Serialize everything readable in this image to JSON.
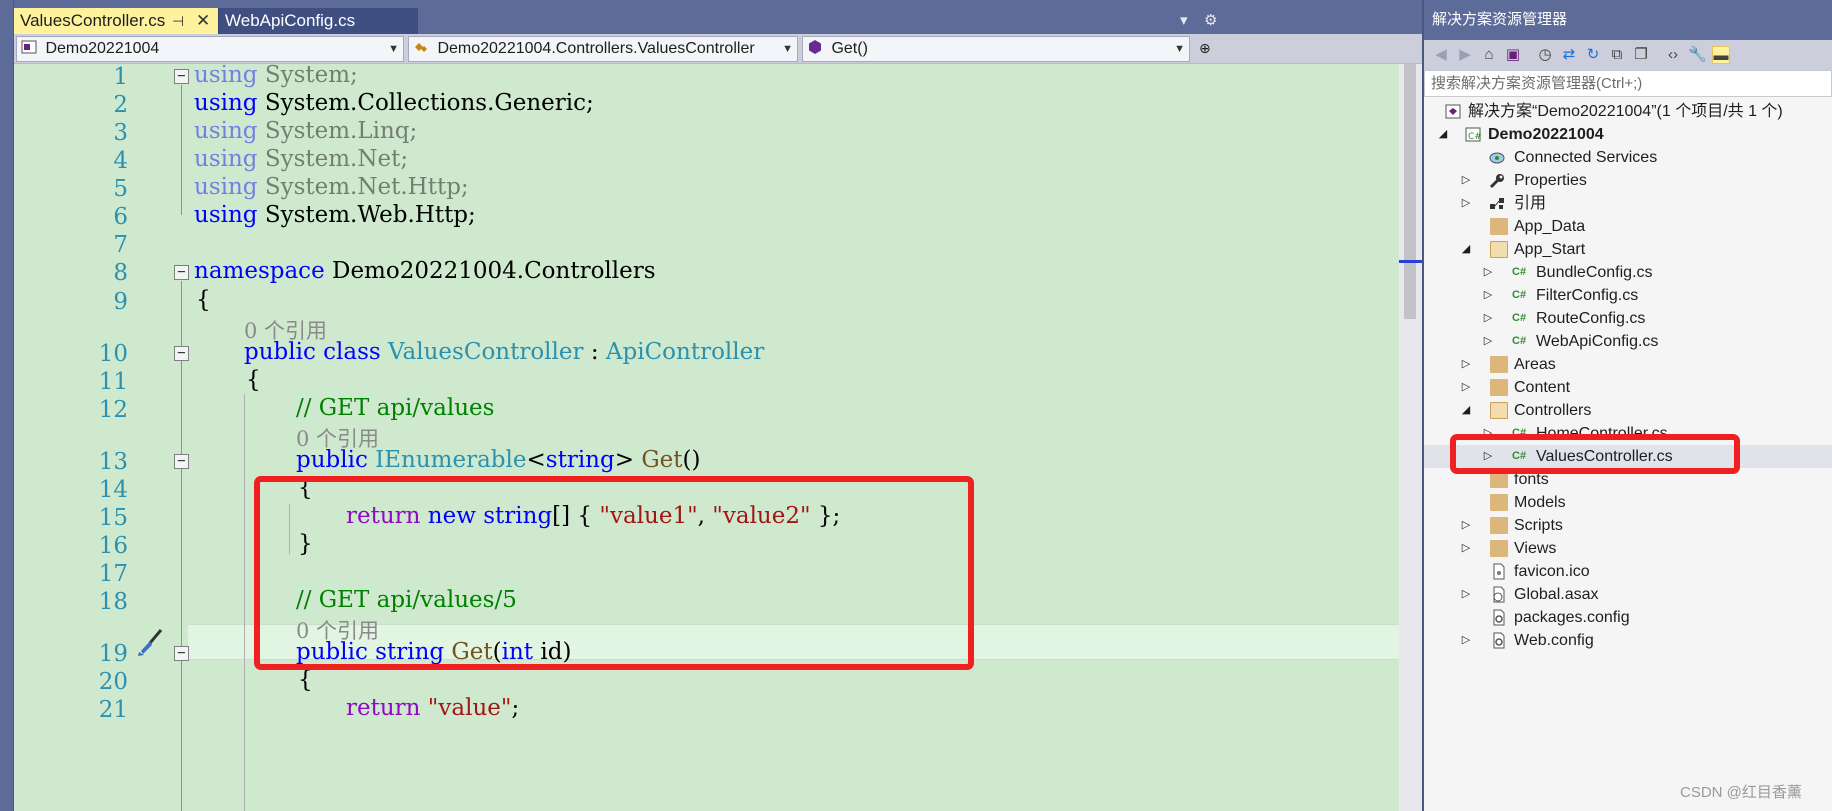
{
  "tabs": [
    {
      "label": "ValuesController.cs",
      "active": true
    },
    {
      "label": "WebApiConfig.cs",
      "active": false
    }
  ],
  "tab_tools": {
    "dropdown": "▾",
    "settings": "⚙"
  },
  "navbar": {
    "project": "Demo20221004",
    "class": "Demo20221004.Controllers.ValuesController",
    "member": "Get()"
  },
  "code": {
    "line_numbers": [
      "1",
      "2",
      "3",
      "4",
      "5",
      "6",
      "7",
      "8",
      "9",
      "10",
      "11",
      "12",
      "13",
      "14",
      "15",
      "16",
      "17",
      "18",
      "19",
      "20",
      "21"
    ],
    "l1_kw": "using",
    "l1_rest": " System;",
    "l2_kw": "using",
    "l2_rest": " System.Collections.Generic;",
    "l3_kw": "using",
    "l3_rest": " System.Linq;",
    "l4_kw": "using",
    "l4_rest": " System.Net;",
    "l5_kw": "using",
    "l5_rest": " System.Net.Http;",
    "l6_kw": "using",
    "l6_rest": " System.Web.Http;",
    "l8_kw": "namespace",
    "l8_rest": " Demo20221004.Controllers",
    "l9": "{",
    "lens1": "0 个引用",
    "l10_kw1": "public",
    "l10_kw2": "class",
    "l10_ty1": "ValuesController",
    "l10_sep": " : ",
    "l10_ty2": "ApiController",
    "l11": "{",
    "l12_cm": "// GET api/values",
    "lens2": "0 个引用",
    "l13_kw": "public",
    "l13_ty": "IEnumerable",
    "l13_lt": "<",
    "l13_kw2": "string",
    "l13_gt": ">",
    "l13_me": "Get",
    "l13_par": "()",
    "l14": "{",
    "l15_ctl": "return",
    "l15_kw": "new",
    "l15_kw2": "string",
    "l15_mid": "[] { ",
    "l15_s1": "\"value1\"",
    "l15_comma": ", ",
    "l15_s2": "\"value2\"",
    "l15_end": " };",
    "l16": "}",
    "l18_cm": "// GET api/values/5",
    "lens3": "0 个引用",
    "l19_kw": "public",
    "l19_kw2": "string",
    "l19_me": "Get",
    "l19_p1": "(",
    "l19_kw3": "int",
    "l19_p2": " id)",
    "l20": "{",
    "l21_ctl": "return",
    "l21_st": "\"value\"",
    "l21_end": ";"
  },
  "solution_explorer": {
    "title": "解决方案资源管理器",
    "search_placeholder": "搜索解决方案资源管理器(Ctrl+;)",
    "items": [
      {
        "label": "解决方案“Demo20221004”(1 个项目/共 1 个)",
        "expander": ""
      },
      {
        "label": "Demo20221004",
        "expander": "◢"
      },
      {
        "label": "Connected Services",
        "expander": ""
      },
      {
        "label": "Properties",
        "expander": "▷"
      },
      {
        "label": "引用",
        "expander": "▷"
      },
      {
        "label": "App_Data",
        "expander": ""
      },
      {
        "label": "App_Start",
        "expander": "◢"
      },
      {
        "label": "BundleConfig.cs",
        "expander": "▷"
      },
      {
        "label": "FilterConfig.cs",
        "expander": "▷"
      },
      {
        "label": "RouteConfig.cs",
        "expander": "▷"
      },
      {
        "label": "WebApiConfig.cs",
        "expander": "▷"
      },
      {
        "label": "Areas",
        "expander": "▷"
      },
      {
        "label": "Content",
        "expander": "▷"
      },
      {
        "label": "Controllers",
        "expander": "◢"
      },
      {
        "label": "HomeController.cs",
        "expander": "▷"
      },
      {
        "label": "ValuesController.cs",
        "expander": "▷"
      },
      {
        "label": "fonts",
        "expander": ""
      },
      {
        "label": "Models",
        "expander": ""
      },
      {
        "label": "Scripts",
        "expander": "▷"
      },
      {
        "label": "Views",
        "expander": "▷"
      },
      {
        "label": "favicon.ico",
        "expander": ""
      },
      {
        "label": "Global.asax",
        "expander": "▷"
      },
      {
        "label": "packages.config",
        "expander": ""
      },
      {
        "label": "Web.config",
        "expander": "▷"
      }
    ]
  },
  "watermark": "CSDN @红目香薰",
  "colors": {
    "highlight_border": "#f02020",
    "editor_bg": "#cfe9cf",
    "chrome": "#5d6b99"
  }
}
